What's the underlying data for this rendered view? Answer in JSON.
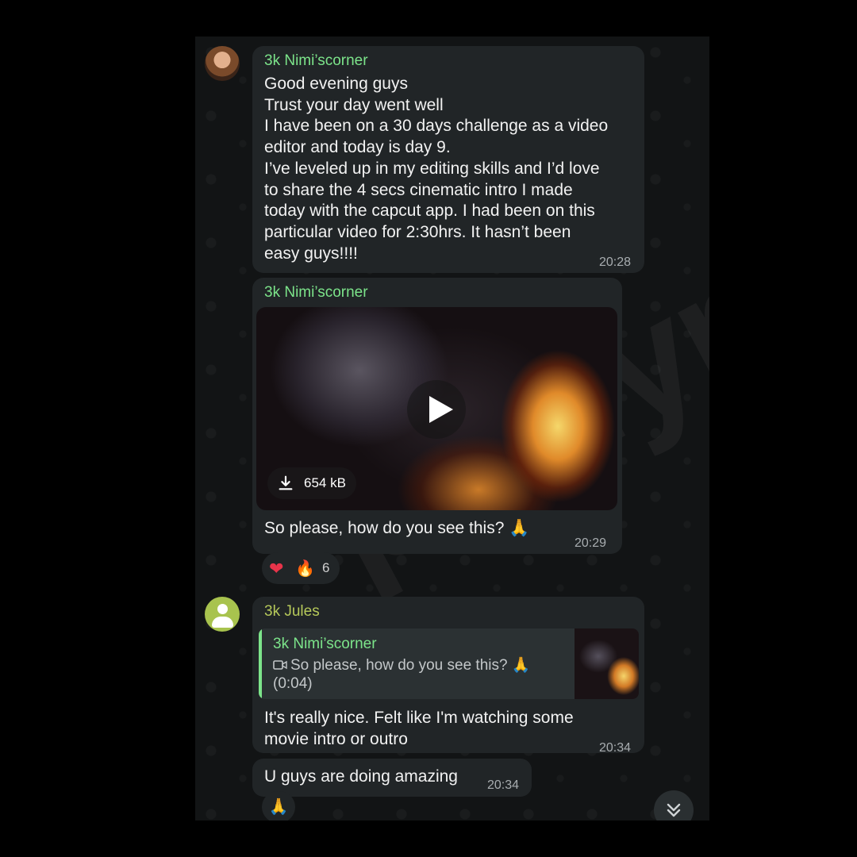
{
  "messages": [
    {
      "sender": "3k Nimi’scorner",
      "text": "Good evening guys\nTrust your day went well\nI have been on a 30 days challenge as a video\neditor and today is day 9.\nI’ve leveled up in my editing skills and I’d love\nto share the 4 secs cinematic intro I made\ntoday with the capcut app. I had been on this\nparticular video for 2:30hrs. It hasn’t been\neasy guys!!!!",
      "time": "20:28"
    },
    {
      "sender": "3k Nimi’scorner",
      "video_size": "654 kB",
      "caption": "So please, how do you see this? 🙏",
      "time": "20:29",
      "reactions": {
        "heart": "❤",
        "fire": "🔥",
        "count": "6"
      }
    },
    {
      "sender": "3k Jules",
      "reply_to": {
        "sender": "3k Nimi’scorner",
        "text": "So please, how do you see this? 🙏",
        "duration": "(0:04)"
      },
      "text": "It's really nice. Felt like I'm watching some\nmovie intro or outro",
      "time": "20:34"
    },
    {
      "text": "U guys are doing amazing",
      "time": "20:34",
      "reaction": "🙏"
    }
  ],
  "watermark": "phillymona",
  "scroll_down_icon": "⌄"
}
